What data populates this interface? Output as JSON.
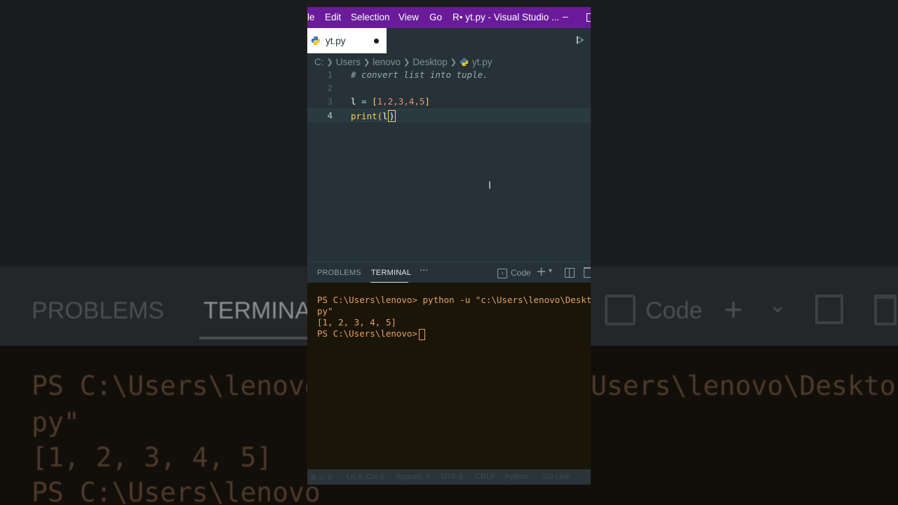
{
  "background_blur": {
    "problems": "PROBLEMS",
    "terminal": "TERMINA",
    "code": "Code",
    "term_line1_left": "PS C:\\Users\\lenovo",
    "term_line1_right": "Users\\lenovo\\Deskto",
    "term_line2": "py\"",
    "term_line3": "[1, 2, 3, 4, 5]",
    "term_line4": "PS C:\\Users\\lenovo"
  },
  "titlebar": {
    "file_menu": "le",
    "edit_menu": "Edit",
    "selection_menu": "Selection",
    "view_menu": "View",
    "go_menu": "Go",
    "title": "R• yt.py - Visual Studio ...",
    "minimize": "–",
    "color": "#6a1b9a"
  },
  "tab": {
    "filename": "yt.py",
    "modified_icon": "dot-icon"
  },
  "breadcrumb": {
    "drive": "C:",
    "users": "Users",
    "user": "lenovo",
    "folder": "Desktop",
    "file": "yt.py"
  },
  "editor": {
    "lines": [
      {
        "num": "1",
        "comment": "# convert list into tuple."
      },
      {
        "num": "2"
      },
      {
        "num": "3",
        "var": "l",
        "op": " = ",
        "open": "[",
        "items": "1,2,3,4,5",
        "close": "]"
      },
      {
        "num": "4",
        "fn": "print",
        "open": "(",
        "arg": "l",
        "close": ")"
      }
    ]
  },
  "panel": {
    "problems_tab": "PROBLEMS",
    "terminal_tab": "TERMINAL",
    "more": "···",
    "shell_name": "Code",
    "plus": "+",
    "chevron": "⌄"
  },
  "terminal": {
    "line1": "PS C:\\Users\\lenovo> python -u \"c:\\Users\\lenovo\\Desktop",
    "line2": "py\"",
    "line3": "[1, 2, 3, 4, 5]",
    "line4": "PS C:\\Users\\lenovo>",
    "text_color": "#e6a15e"
  },
  "statusbar": {
    "problems": "⊗ ⚠ 0",
    "position": "Ln 4, Col 6",
    "spaces": "Spaces: 4",
    "encoding": "UTF-8",
    "eol": "CRLF",
    "language": "Python",
    "go_live": "Go Live"
  }
}
